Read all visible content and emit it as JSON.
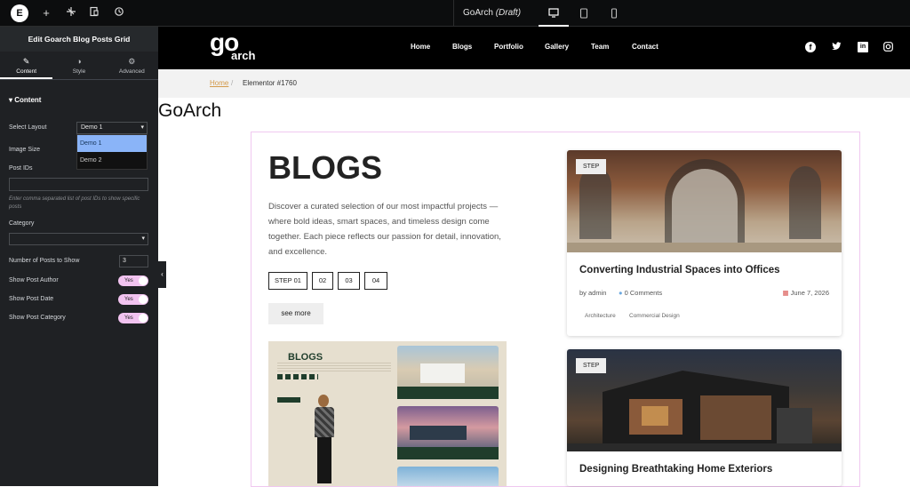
{
  "topbar": {
    "logo": "E",
    "doc_title": "GoArch",
    "doc_status": "(Draft)",
    "icons": [
      "add-icon",
      "structure-icon",
      "pages-icon",
      "history-icon"
    ],
    "devices": [
      "desktop-icon",
      "tablet-icon",
      "mobile-icon"
    ]
  },
  "panel": {
    "title": "Edit Goarch Blog Posts Grid",
    "tabs": [
      {
        "label": "Content",
        "icon": "pencil-icon"
      },
      {
        "label": "Style",
        "icon": "contrast-icon"
      },
      {
        "label": "Advanced",
        "icon": "gear-icon"
      }
    ],
    "section": "Content",
    "select_layout_label": "Select Layout",
    "select_layout_value": "Demo 1",
    "layout_options": [
      "Demo 1",
      "Demo 2"
    ],
    "image_size_label": "Image Size",
    "post_ids_label": "Post IDs",
    "post_ids_help": "Enter comma separated list of post IDs to show specific posts",
    "category_label": "Category",
    "num_posts_label": "Number of Posts to Show",
    "num_posts_value": "3",
    "toggles": [
      {
        "label": "Show Post Author",
        "value": "Yes"
      },
      {
        "label": "Show Post Date",
        "value": "Yes"
      },
      {
        "label": "Show Post Category",
        "value": "Yes"
      }
    ]
  },
  "site": {
    "logo_text_top": "go",
    "logo_text_bottom": "arch",
    "nav": [
      "Home",
      "Blogs",
      "Portfolio",
      "Gallery",
      "Team",
      "Contact"
    ],
    "social": [
      "facebook-icon",
      "twitter-icon",
      "linkedin-icon",
      "instagram-icon"
    ]
  },
  "breadcrumb": {
    "home": "Home",
    "sep": "/",
    "current": "Elementor #1760"
  },
  "page_title": "GoArch",
  "blog": {
    "heading": "BLOGS",
    "description": "Discover a curated selection of our most impactful projects — where bold ideas, smart spaces, and timeless design come together. Each piece reflects our passion for detail, innovation, and excellence.",
    "steps": [
      "STEP 01",
      "02",
      "03",
      "04"
    ],
    "see_more": "see more",
    "thumb_heading": "BLOGS"
  },
  "posts": [
    {
      "badge": "STEP",
      "title": "Converting Industrial Spaces into Offices",
      "author": "by admin",
      "comments": "0 Comments",
      "date": "June 7, 2026",
      "tags": [
        "Architecture",
        "Commercial Design"
      ]
    },
    {
      "badge": "STEP",
      "title": "Designing Breathtaking Home Exteriors"
    }
  ],
  "colors": {
    "accent": "#f2c3f0",
    "dark": "#1f2124",
    "breadcrumb_link": "#d39a4a"
  }
}
